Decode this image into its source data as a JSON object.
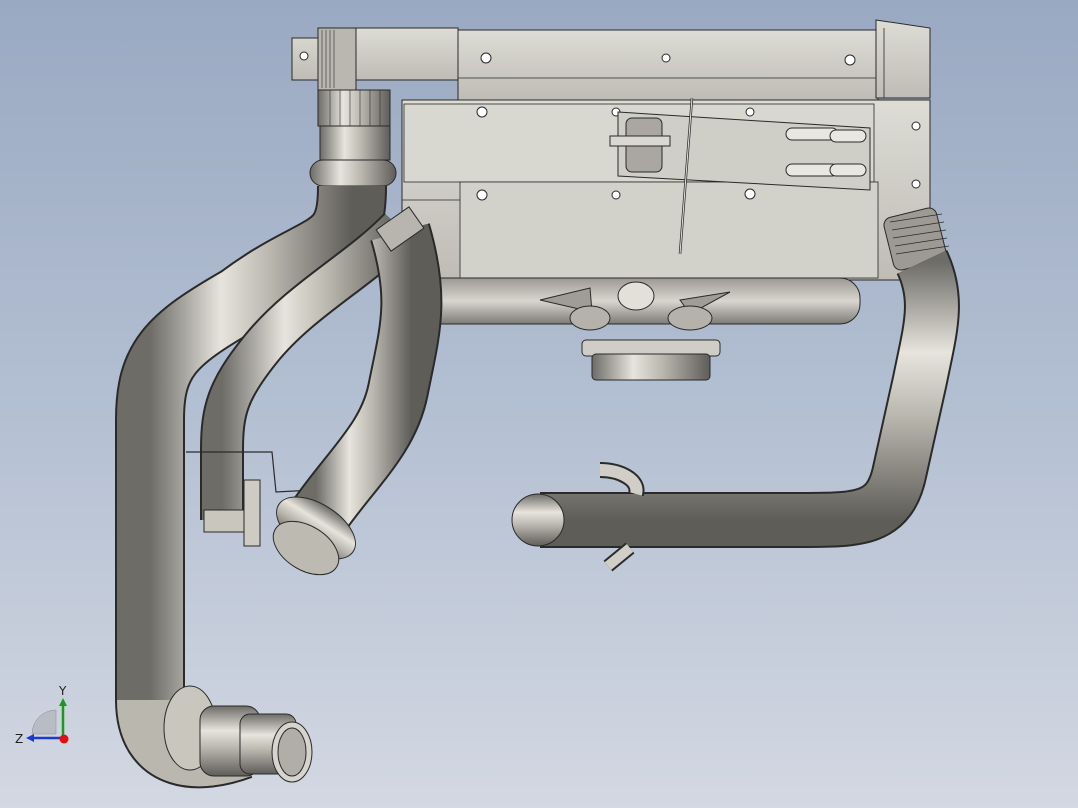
{
  "view": {
    "background_top": "#9aa9c2",
    "background_bottom": "#d3d8e2",
    "model_colors": {
      "metal": "#c9c6be",
      "metal_dark": "#8d8a83",
      "edges": "#2a2a2a",
      "body_fill": "#d4d3cc"
    }
  },
  "triad": {
    "y_label": "Y",
    "z_label": "Z",
    "y_color": "#1a9a1a",
    "z_color": "#1a3ad0",
    "x_color": "#e01010"
  }
}
